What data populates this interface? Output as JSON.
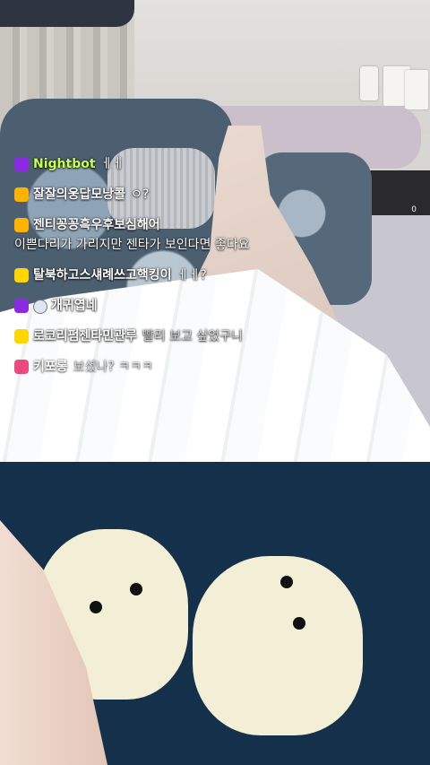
{
  "stream": {
    "side_indicator": "0"
  },
  "chat": {
    "messages": [
      {
        "nickname": "Nightbot",
        "text": "ㅔㅔ",
        "badge_color": "#8a2be2"
      },
      {
        "nickname": "잘잘의웅답모낭콜",
        "text": "ㅇ?",
        "badge_color": "#ffb300"
      },
      {
        "nickname": "젠티꽁꽁흑우후보심해어",
        "text": "이쁜다리가 가리지만 젠타가 보인다면 좋다요",
        "badge_color": "#ffb300"
      },
      {
        "nickname": "탈북하고스섀례쓰고핵킹이",
        "text": "ㅔㅔ?",
        "badge_color": "#ffd600"
      },
      {
        "nickname": "개귀엽네",
        "text": "",
        "badge_color": "#8a2be2"
      },
      {
        "nickname": "로코리펌젠타민관루",
        "text": "빨리 보고 싶었구니",
        "badge_color": "#ffd600"
      },
      {
        "nickname": "키포롱",
        "text": "보셨나? ㅋㅋㅋ",
        "badge_color": "#e91e63"
      }
    ]
  }
}
